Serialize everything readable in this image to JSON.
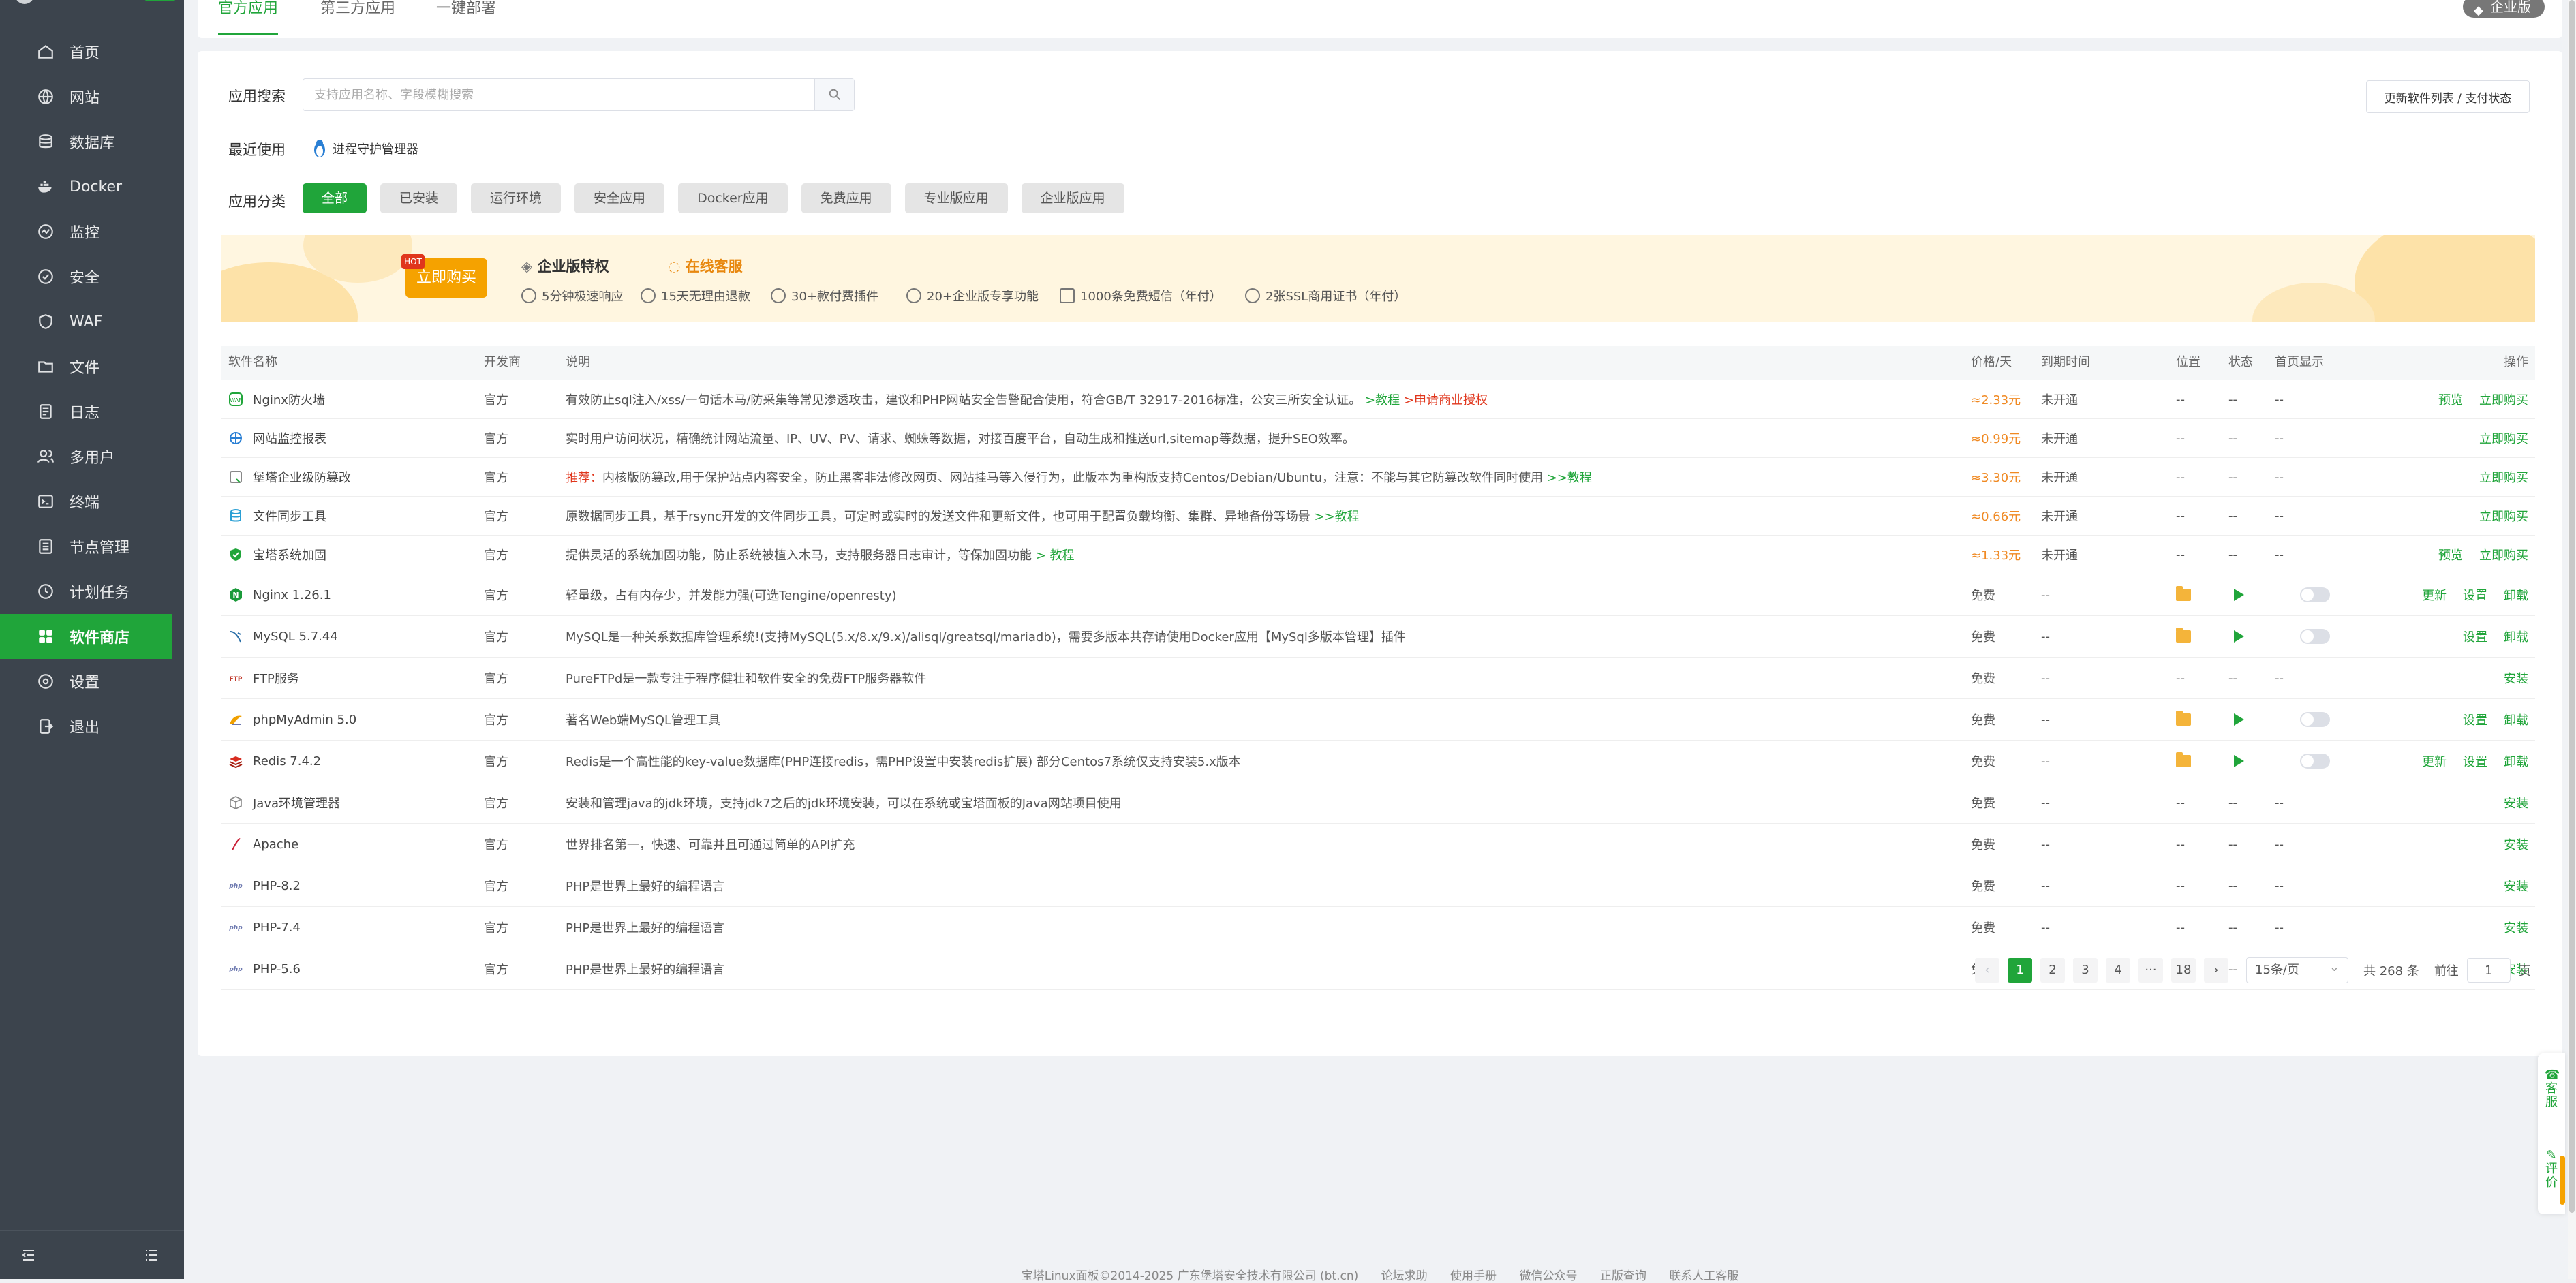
{
  "sidebar": {
    "items": [
      {
        "label": "首页",
        "icon": "home-icon"
      },
      {
        "label": "网站",
        "icon": "globe-icon"
      },
      {
        "label": "数据库",
        "icon": "database-icon"
      },
      {
        "label": "Docker",
        "icon": "docker-icon"
      },
      {
        "label": "监控",
        "icon": "monitor-icon"
      },
      {
        "label": "安全",
        "icon": "shield-icon"
      },
      {
        "label": "WAF",
        "icon": "waf-icon"
      },
      {
        "label": "文件",
        "icon": "folder-icon"
      },
      {
        "label": "日志",
        "icon": "log-icon"
      },
      {
        "label": "多用户",
        "icon": "users-icon"
      },
      {
        "label": "终端",
        "icon": "terminal-icon"
      },
      {
        "label": "节点管理",
        "icon": "node-icon"
      },
      {
        "label": "计划任务",
        "icon": "clock-icon"
      },
      {
        "label": "软件商店",
        "icon": "store-icon",
        "active": true
      },
      {
        "label": "设置",
        "icon": "gear-icon"
      },
      {
        "label": "退出",
        "icon": "logout-icon"
      }
    ]
  },
  "tabs": {
    "official": "官方应用",
    "third": "第三方应用",
    "deploy": "一键部署"
  },
  "badge": {
    "enterprise": "企业版"
  },
  "search": {
    "label": "应用搜索",
    "placeholder": "支持应用名称、字段模糊搜索",
    "value": ""
  },
  "update_btn": "更新软件列表 / 支付状态",
  "recent": {
    "label": "最近使用",
    "item": "进程守护管理器"
  },
  "categories": {
    "label": "应用分类",
    "items": [
      "全部",
      "已安装",
      "运行环境",
      "安全应用",
      "Docker应用",
      "免费应用",
      "专业版应用",
      "企业版应用"
    ]
  },
  "banner": {
    "buy": "立即购买",
    "hot": "HOT",
    "feature_title": "企业版特权",
    "service": "在线客服",
    "features": [
      "5分钟极速响应",
      "15天无理由退款",
      "30+款付费插件",
      "20+企业版专享功能",
      "1000条免费短信（年付）",
      "2张SSL商用证书（年付）"
    ]
  },
  "table": {
    "headers": {
      "name": "软件名称",
      "dev": "开发商",
      "desc": "说明",
      "price": "价格/天",
      "expire": "到期时间",
      "pos": "位置",
      "status": "状态",
      "home": "首页显示",
      "ops": "操作"
    },
    "rows": [
      {
        "name": "Nginx防火墙",
        "dev": "官方",
        "desc": "有效防止sql注入/xss/一句话木马/防采集等常见渗透攻击，建议和PHP网站安全告警配合使用，符合GB/T 32917-2016标准，公安三所安全认证。",
        "link1": ">教程",
        "link2": ">申请商业授权",
        "price": "≈2.33元",
        "expire": "未开通",
        "pos": "--",
        "status": "--",
        "home": "--",
        "op1": "预览",
        "op2": "立即购买"
      },
      {
        "name": "网站监控报表",
        "dev": "官方",
        "desc": "实时用户访问状况，精确统计网站流量、IP、UV、PV、请求、蜘蛛等数据，对接百度平台，自动生成和推送url,sitemap等数据，提升SEO效率。",
        "price": "≈0.99元",
        "expire": "未开通",
        "pos": "--",
        "status": "--",
        "home": "--",
        "op1": "立即购买"
      },
      {
        "name": "堡塔企业级防篡改",
        "dev": "官方",
        "prefix": "推荐：",
        "desc": "内核版防篡改,用于保护站点内容安全，防止黑客非法修改网页、网站挂马等入侵行为，此版本为重构版支持Centos/Debian/Ubuntu，注意：不能与其它防篡改软件同时使用",
        "link1": ">>教程",
        "price": "≈3.30元",
        "expire": "未开通",
        "pos": "--",
        "status": "--",
        "home": "--",
        "op1": "立即购买"
      },
      {
        "name": "文件同步工具",
        "dev": "官方",
        "desc": "原数据同步工具，基于rsync开发的文件同步工具，可定时或实时的发送文件和更新文件，也可用于配置负载均衡、集群、异地备份等场景",
        "link1": ">>教程",
        "price": "≈0.66元",
        "expire": "未开通",
        "pos": "--",
        "status": "--",
        "home": "--",
        "op1": "立即购买"
      },
      {
        "name": "宝塔系统加固",
        "dev": "官方",
        "desc": "提供灵活的系统加固功能，防止系统被植入木马，支持服务器日志审计，等保加固功能",
        "link1": "> 教程",
        "price": "≈1.33元",
        "expire": "未开通",
        "pos": "--",
        "status": "--",
        "home": "--",
        "op1": "预览",
        "op2": "立即购买"
      },
      {
        "name": "Nginx 1.26.1",
        "dev": "官方",
        "desc": "轻量级，占有内存少，并发能力强(可选Tengine/openresty)",
        "price": "免费",
        "expire": "--",
        "op1": "更新",
        "op2": "设置",
        "op3": "卸载"
      },
      {
        "name": "MySQL 5.7.44",
        "dev": "官方",
        "desc": "MySQL是一种关系数据库管理系统!(支持MySQL(5.x/8.x/9.x)/alisql/greatsql/mariadb)，需要多版本共存请使用Docker应用【MySql多版本管理】插件",
        "price": "免费",
        "expire": "--",
        "op1": "设置",
        "op2": "卸载"
      },
      {
        "name": "FTP服务",
        "dev": "官方",
        "desc": "PureFTPd是一款专注于程序健壮和软件安全的免费FTP服务器软件",
        "price": "免费",
        "expire": "--",
        "pos": "--",
        "status": "--",
        "home": "--",
        "op1": "安装"
      },
      {
        "name": "phpMyAdmin 5.0",
        "dev": "官方",
        "desc": "著名Web端MySQL管理工具",
        "price": "免费",
        "expire": "--",
        "op1": "设置",
        "op2": "卸载"
      },
      {
        "name": "Redis 7.4.2",
        "dev": "官方",
        "desc": "Redis是一个高性能的key-value数据库(PHP连接redis，需PHP设置中安装redis扩展) 部分Centos7系统仅支持安装5.x版本",
        "price": "免费",
        "expire": "--",
        "op1": "更新",
        "op2": "设置",
        "op3": "卸载"
      },
      {
        "name": "Java环境管理器",
        "dev": "官方",
        "desc": "安装和管理java的jdk环境，支持jdk7之后的jdk环境安装，可以在系统或宝塔面板的Java网站项目使用",
        "price": "免费",
        "expire": "--",
        "pos": "--",
        "status": "--",
        "home": "--",
        "op1": "安装"
      },
      {
        "name": "Apache",
        "dev": "官方",
        "desc": "世界排名第一，快速、可靠并且可通过简单的API扩充",
        "price": "免费",
        "expire": "--",
        "pos": "--",
        "status": "--",
        "home": "--",
        "op1": "安装"
      },
      {
        "name": "PHP-8.2",
        "dev": "官方",
        "desc": "PHP是世界上最好的编程语言",
        "price": "免费",
        "expire": "--",
        "pos": "--",
        "status": "--",
        "home": "--",
        "op1": "安装"
      },
      {
        "name": "PHP-7.4",
        "dev": "官方",
        "desc": "PHP是世界上最好的编程语言",
        "price": "免费",
        "expire": "--",
        "pos": "--",
        "status": "--",
        "home": "--",
        "op1": "安装"
      },
      {
        "name": "PHP-5.6",
        "dev": "官方",
        "desc": "PHP是世界上最好的编程语言",
        "price": "免费",
        "expire": "--",
        "pos": "--",
        "status": "--",
        "home": "--",
        "op1": "安装"
      }
    ]
  },
  "pager": {
    "prev": "‹",
    "next": "›",
    "pages": [
      "1",
      "2",
      "3",
      "4",
      "···",
      "18"
    ],
    "per_page": "15条/页",
    "total": "共 268 条",
    "goto": "前往",
    "goto_value": "1",
    "page_unit": "页"
  },
  "float": {
    "service": "客服",
    "review": "评价"
  },
  "footer": {
    "copyright": "宝塔Linux面板©2014-2025 广东堡塔安全技术有限公司 (bt.cn)",
    "forum": "论坛求助",
    "manual": "使用手册",
    "wechat": "微信公众号",
    "check": "正版查询",
    "contact": "联系人工客服"
  },
  "colors": {
    "accent": "#20a53a",
    "sidebar": "#3c444d",
    "price": "#f08a24",
    "link_red": "#e0361c",
    "banner_bg": "#fff6e0"
  }
}
